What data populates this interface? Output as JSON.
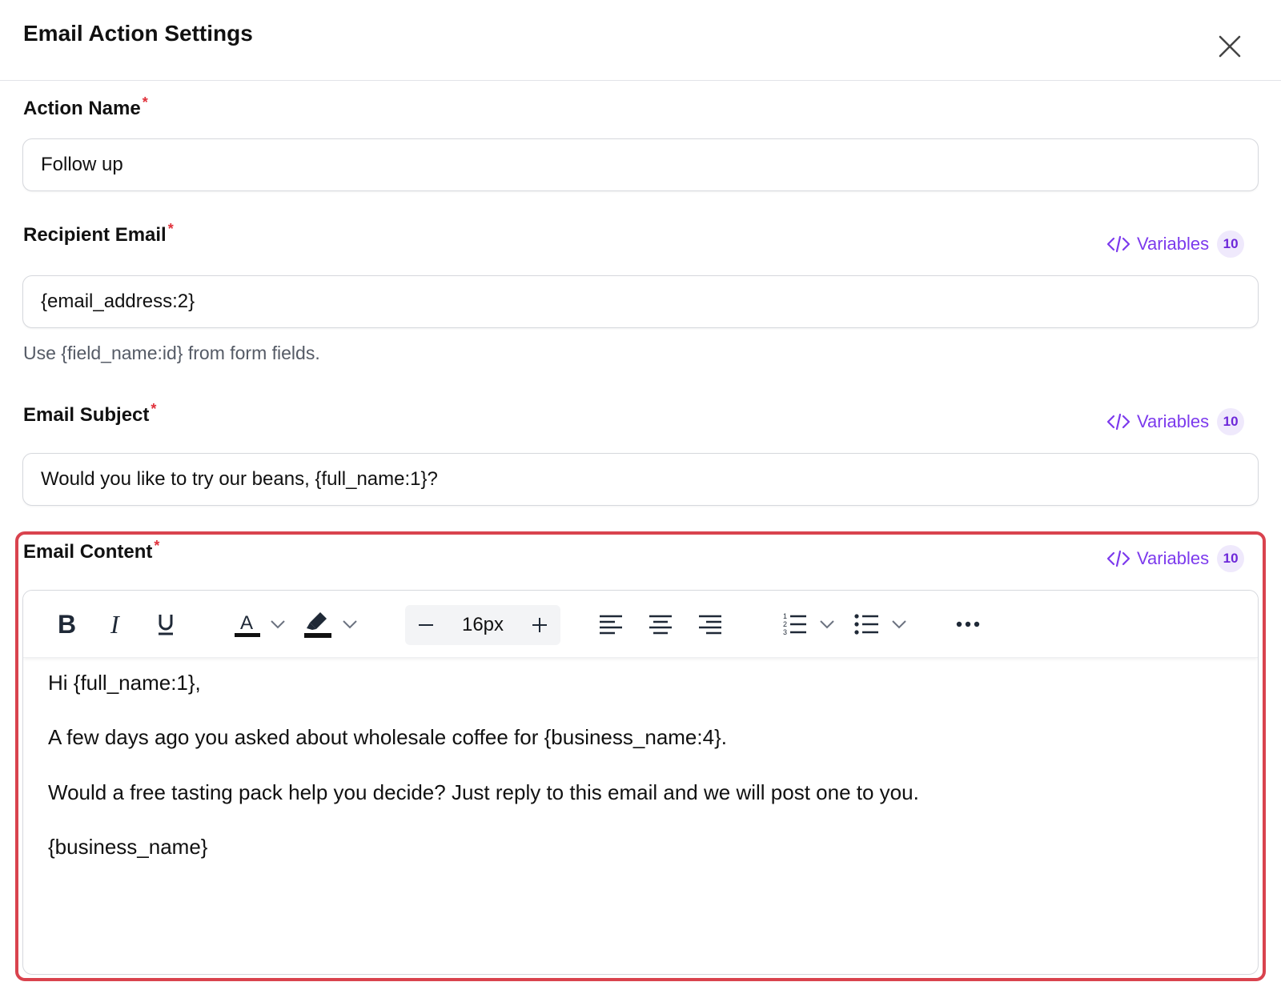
{
  "header": {
    "title": "Email Action Settings",
    "close_icon": "close-icon"
  },
  "action_name": {
    "label": "Action Name",
    "required_mark": "*",
    "value": "Follow up"
  },
  "recipient_email": {
    "label": "Recipient Email",
    "required_mark": "*",
    "value": "{email_address:2}",
    "hint": "Use {field_name:id} from form fields.",
    "variables_label": "Variables",
    "variables_count": "10"
  },
  "email_subject": {
    "label": "Email Subject",
    "required_mark": "*",
    "value": "Would you like to try our beans, {full_name:1}?",
    "variables_label": "Variables",
    "variables_count": "10"
  },
  "email_content": {
    "label": "Email Content",
    "required_mark": "*",
    "variables_label": "Variables",
    "variables_count": "10",
    "toolbar": {
      "buttons": [
        "bold-icon",
        "italic-icon",
        "underline-icon",
        "text-color-icon",
        "highlight-icon",
        "decrease-font-icon",
        "increase-font-icon",
        "align-left-icon",
        "align-center-icon",
        "align-right-icon",
        "numbered-list-icon",
        "bullet-list-icon",
        "more-icon"
      ],
      "font_size": "16px"
    },
    "body": [
      "Hi {full_name:1},",
      "A few days ago you asked about wholesale coffee for {business_name:4}.",
      "Would a free tasting pack help you decide? Just reply to this email and we will post one to you.",
      "{business_name}"
    ]
  },
  "colors": {
    "accent": "#7c3aed",
    "required": "#e0313b",
    "highlight_border": "#d9434e"
  }
}
